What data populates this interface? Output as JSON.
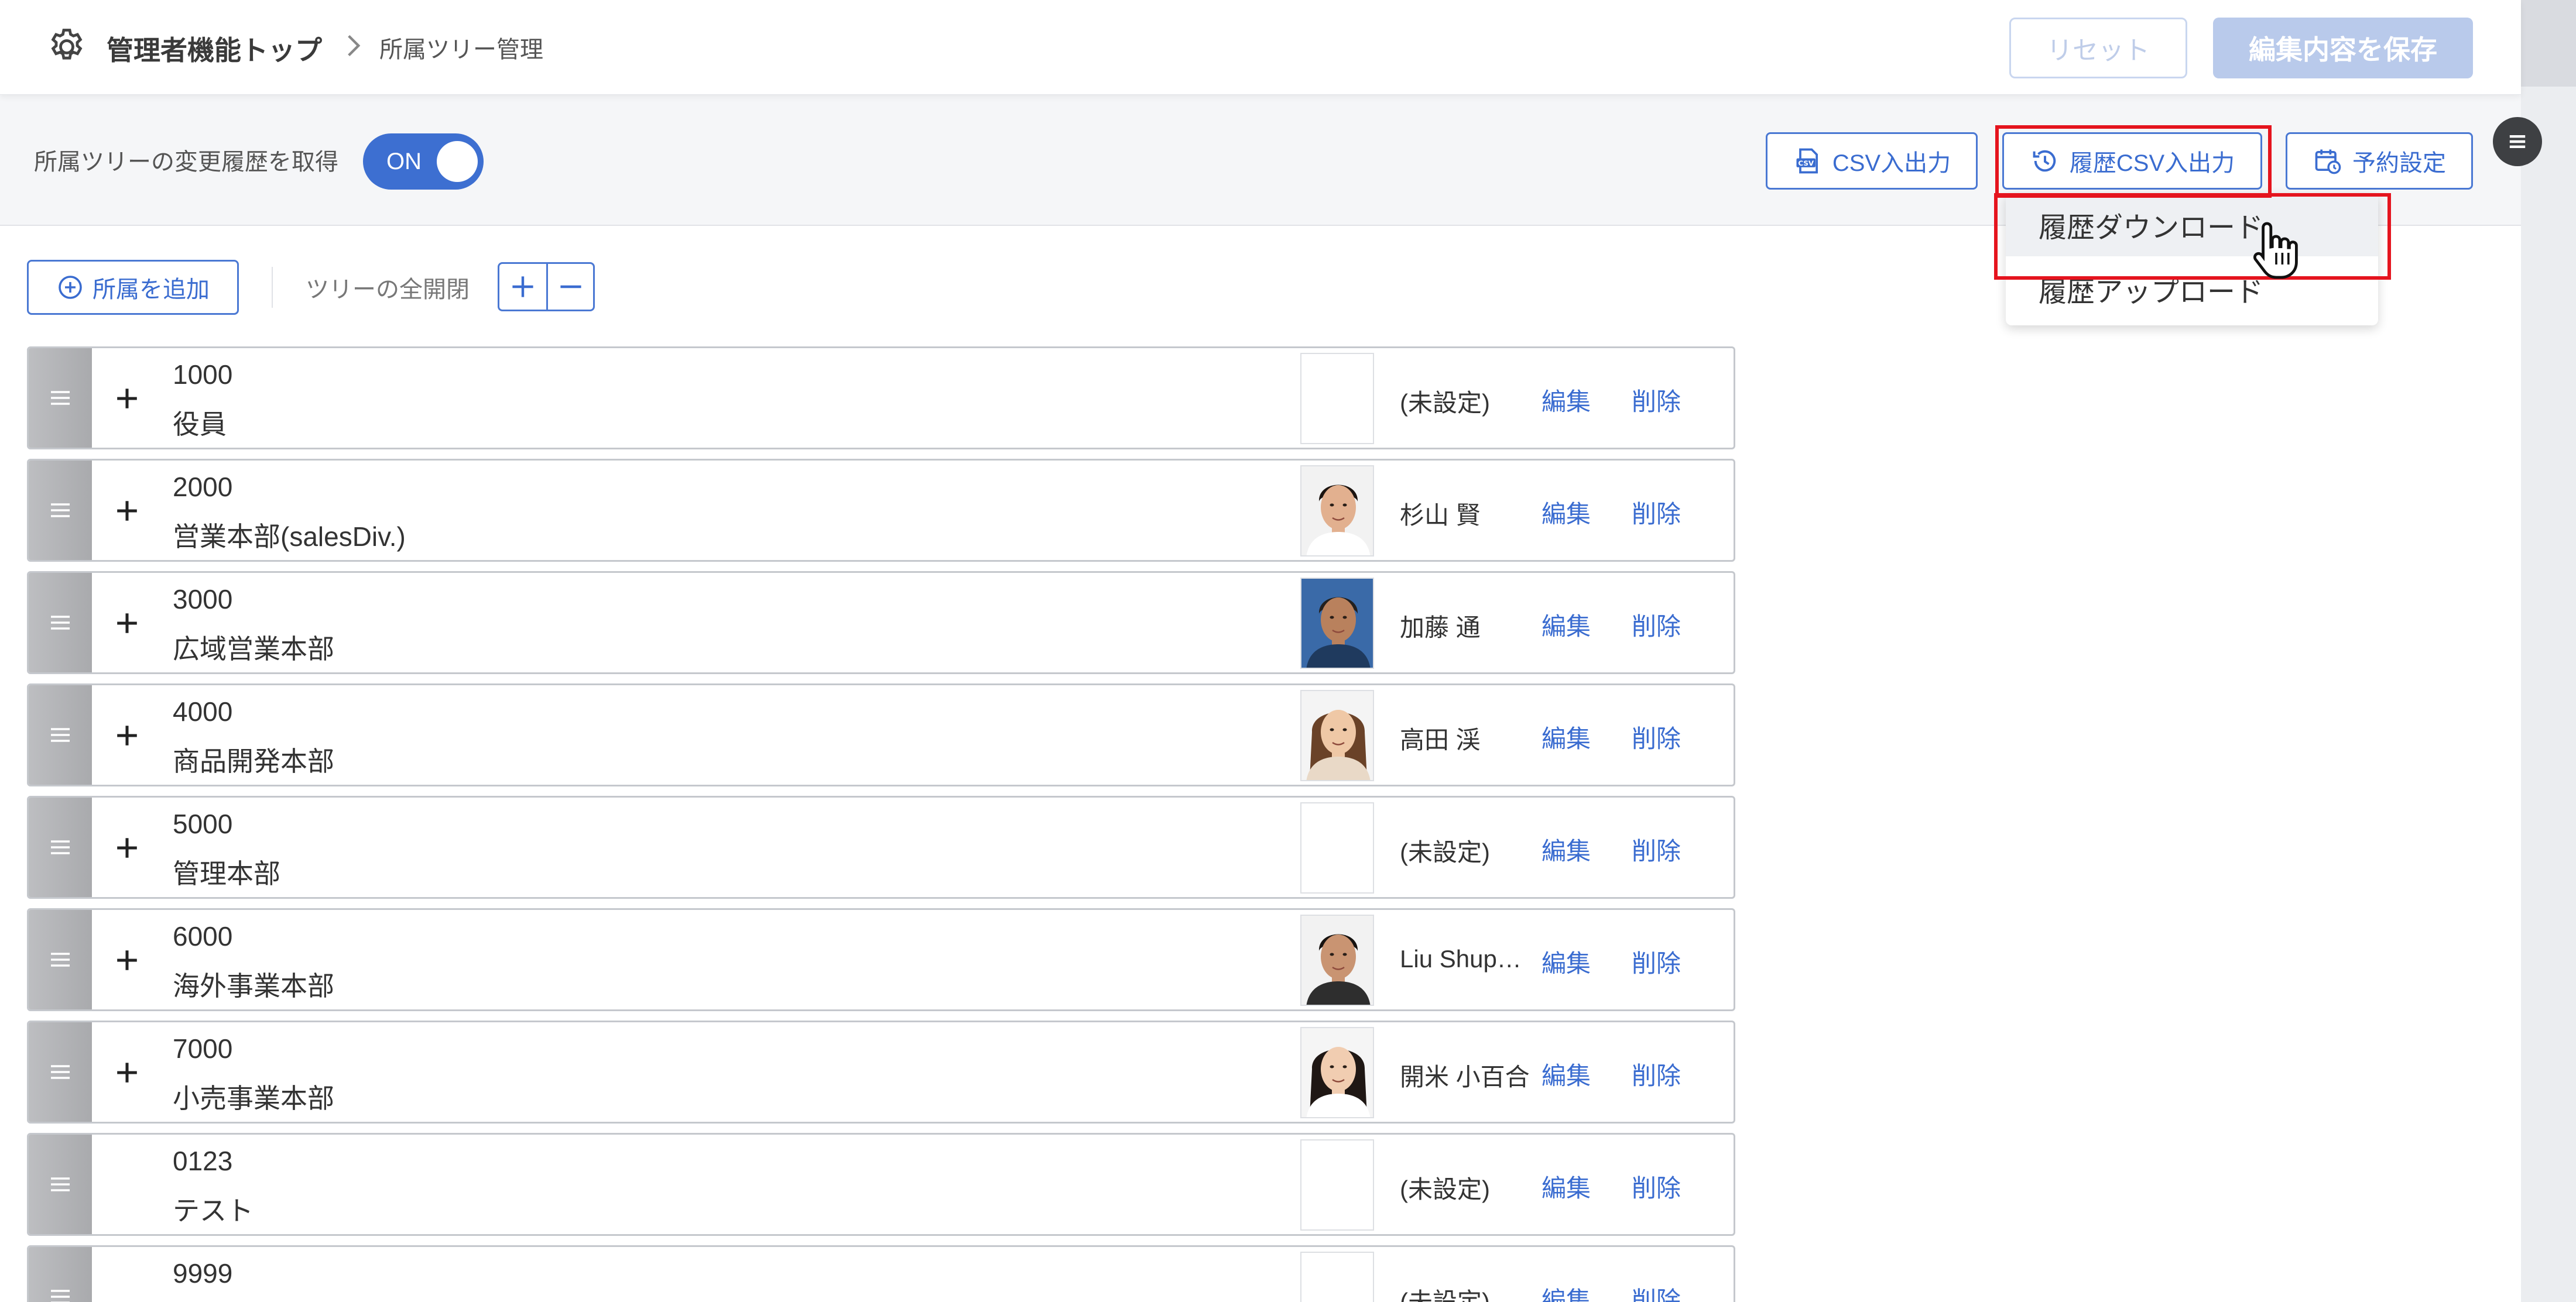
{
  "header": {
    "breadcrumb_top": "管理者機能トップ",
    "breadcrumb_current": "所属ツリー管理",
    "reset_label": "リセット",
    "save_label": "編集内容を保存"
  },
  "settings": {
    "history_label": "所属ツリーの変更履歴を取得",
    "toggle_label": "ON",
    "csv_button": "CSV入出力",
    "history_csv_button": "履歴CSV入出力",
    "schedule_button": "予約設定"
  },
  "dropdown": {
    "items": [
      "履歴ダウンロード",
      "履歴アップロード"
    ]
  },
  "toolbar": {
    "add_label": "所属を追加",
    "expand_label": "ツリーの全開閉"
  },
  "rows": [
    {
      "code": "1000",
      "name": "役員",
      "manager": "(未設定)",
      "photo": "none"
    },
    {
      "code": "2000",
      "name": "営業本部(salesDiv.)",
      "manager": "杉山 賢",
      "photo": "man-1"
    },
    {
      "code": "3000",
      "name": "広域営業本部",
      "manager": "加藤 通",
      "photo": "man-2"
    },
    {
      "code": "4000",
      "name": "商品開発本部",
      "manager": "高田 渓",
      "photo": "woman-1"
    },
    {
      "code": "5000",
      "name": "管理本部",
      "manager": "(未設定)",
      "photo": "none"
    },
    {
      "code": "6000",
      "name": "海外事業本部",
      "manager": "Liu Shup…",
      "photo": "man-3"
    },
    {
      "code": "7000",
      "name": "小売事業本部",
      "manager": "開米 小百合",
      "photo": "woman-2"
    },
    {
      "code": "0123",
      "name": "テスト",
      "manager": "(未設定)",
      "photo": "none"
    },
    {
      "code": "9999",
      "name": "",
      "manager": "(未設定)",
      "photo": "none"
    }
  ],
  "row_actions": {
    "edit": "編集",
    "delete": "削除"
  },
  "colors": {
    "accent": "#3d6fd1",
    "highlight": "#e5141e",
    "save_disabled": "#b9caeb"
  }
}
